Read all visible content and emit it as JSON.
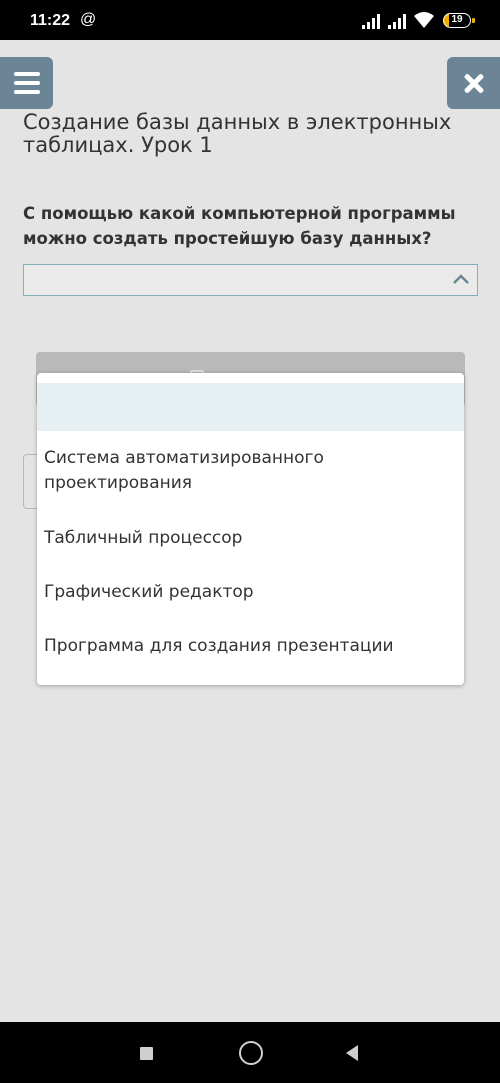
{
  "status_bar": {
    "time": "11:22",
    "at_symbol": "@",
    "battery": "19",
    "battery_level": 0.19
  },
  "page_title": "Создание базы данных в электронных таблицах. Урок 1",
  "question": "С помощью какой компьютерной программы можно создать простейшую базу данных?",
  "dropdown": {
    "selected": "",
    "options": [
      "Система автоматизированного проектирования",
      "Табличный процессор",
      "Графический редактор",
      "Программа для создания презентации"
    ]
  },
  "icons": {
    "menu": "hamburger-icon",
    "close": "close-icon",
    "chevron": "chevron-up-icon",
    "nav_recent": "square-icon",
    "nav_home": "circle-icon",
    "nav_back": "triangle-back-icon"
  },
  "colors": {
    "accent_button": "#6b8596",
    "select_border": "#86aeb8",
    "dropdown_highlight": "#e6f0f3"
  }
}
